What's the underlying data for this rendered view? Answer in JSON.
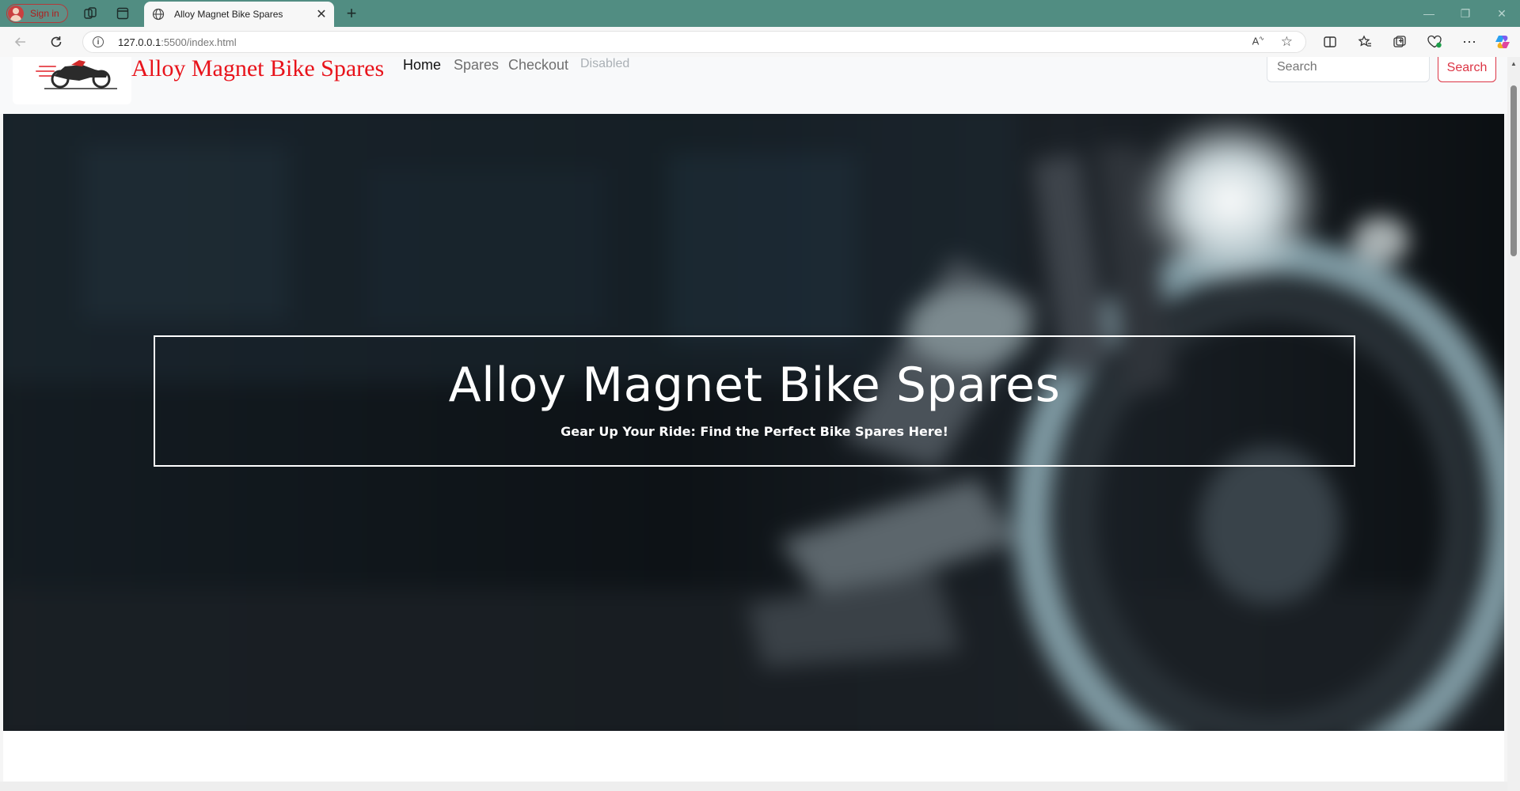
{
  "browser": {
    "signin_label": "Sign in",
    "tab_title": "Alloy Magnet Bike Spares",
    "url_host": "127.0.0.1",
    "url_rest": ":5500/index.html"
  },
  "navbar": {
    "brand": "Alloy Magnet Bike Spares",
    "links": [
      "Home",
      "Spares",
      "Checkout",
      "Disabled"
    ],
    "search_placeholder": "Search",
    "search_button": "Search"
  },
  "hero": {
    "title": "Alloy Magnet Bike Spares",
    "subtitle": "Gear Up Your Ride: Find the Perfect Bike Spares Here!"
  },
  "colors": {
    "tabstrip": "#518d82",
    "brand": "#e8131b",
    "search_button": "#dc3545"
  }
}
